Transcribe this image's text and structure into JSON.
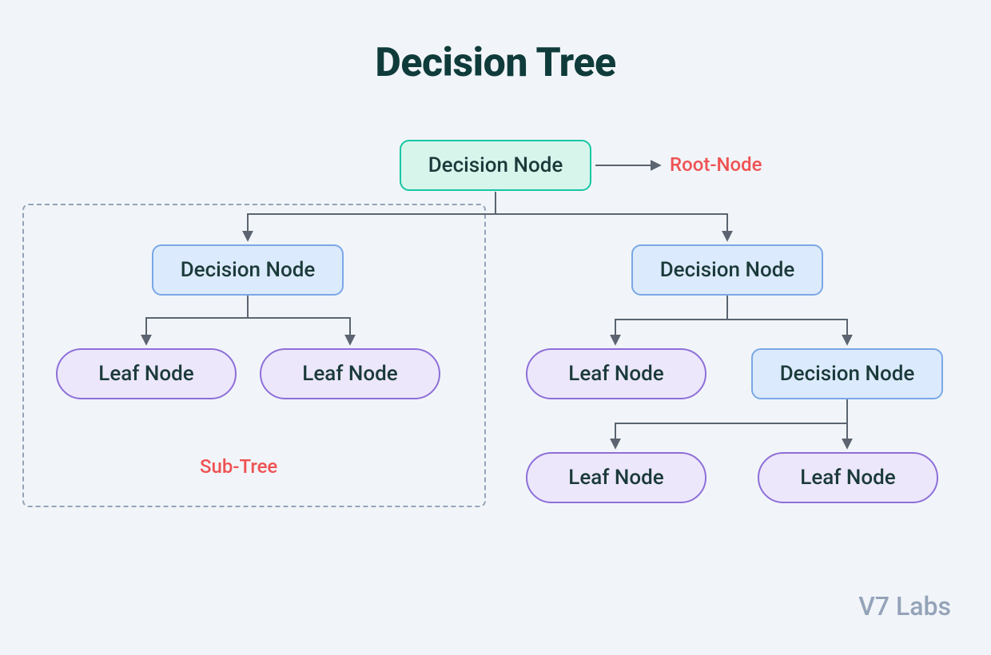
{
  "title": "Decision Tree",
  "nodes": {
    "root": "Decision Node",
    "left": "Decision Node",
    "right": "Decision Node",
    "left_leaf1": "Leaf Node",
    "left_leaf2": "Leaf Node",
    "right_leaf1": "Leaf Node",
    "right_decision": "Decision Node",
    "bottom_leaf1": "Leaf Node",
    "bottom_leaf2": "Leaf Node"
  },
  "annotations": {
    "root_label": "Root-Node",
    "subtree_label": "Sub-Tree"
  },
  "watermark": "V7 Labs",
  "colors": {
    "root_border": "#17c6a3",
    "root_fill": "#d8f5ec",
    "decision_border": "#7aa8e6",
    "decision_fill": "#dceafd",
    "leaf_border": "#8e6fd8",
    "leaf_fill": "#ece7fb",
    "annotation": "#ef5253",
    "connector": "#5b6470",
    "dash": "#94a3b8",
    "watermark": "#94a3b8",
    "bg": "#f1f5f9"
  }
}
